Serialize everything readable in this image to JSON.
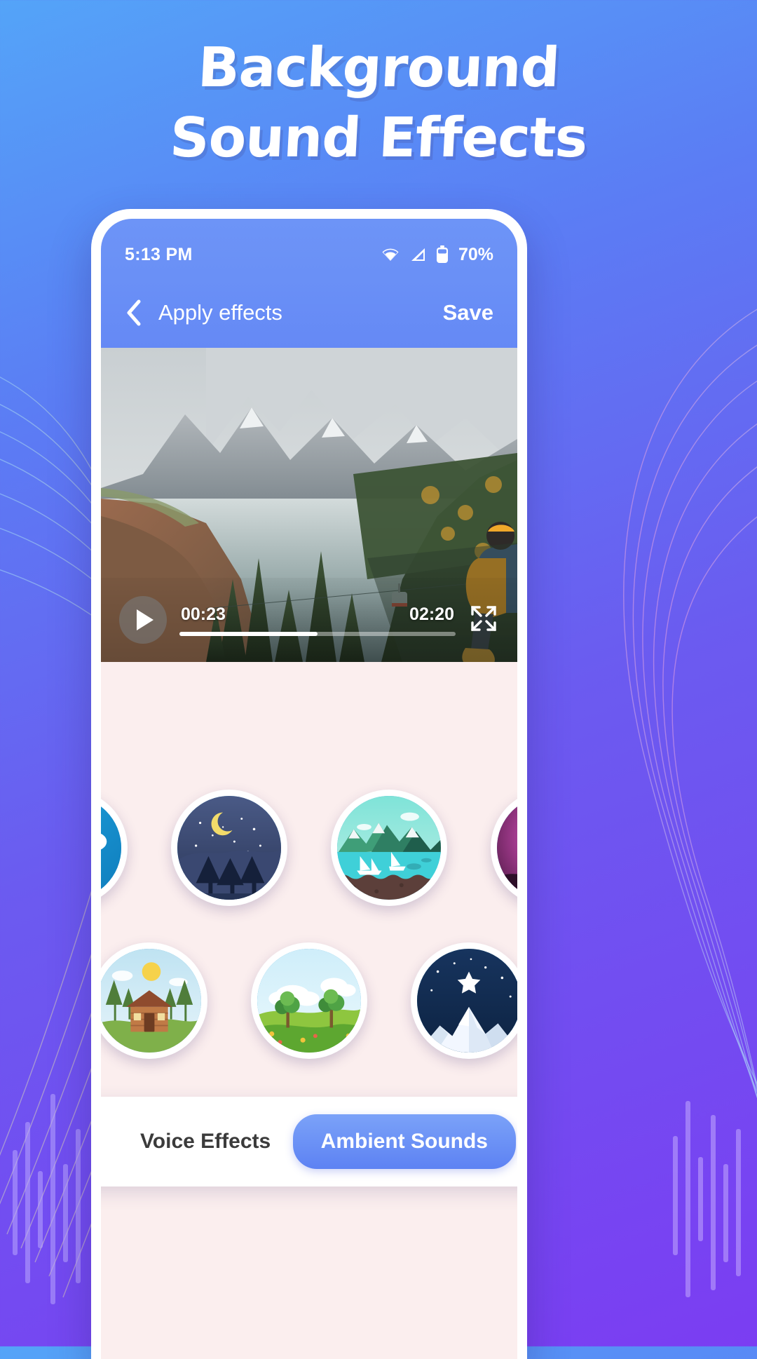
{
  "poster": {
    "title_line1": "Background",
    "title_line2": "Sound Effects",
    "bg_gradient_from": "#54a4f8",
    "bg_gradient_to": "#7b3df2"
  },
  "status_bar": {
    "time": "5:13 PM",
    "battery_percent": "70%",
    "icons": [
      "wifi-icon",
      "cellular-signal-icon",
      "battery-icon"
    ]
  },
  "app_bar": {
    "back_icon": "chevron-left-icon",
    "title": "Apply effects",
    "save_label": "Save",
    "accent": "#6a90f6"
  },
  "video": {
    "play_icon": "play-icon",
    "current_time": "00:23",
    "duration": "02:20",
    "progress_percent": 50,
    "fullscreen_icon": "fullscreen-expand-icon"
  },
  "tabs": {
    "inactive_label": "Voice Effects",
    "active_label": "Ambient Sounds",
    "active_color": "#5d82f3"
  },
  "sounds": {
    "row1": [
      {
        "name": "rain-thunder-sound",
        "icon": "rain-cloud-lightning-icon"
      },
      {
        "name": "night-forest-sound",
        "icon": "crescent-moon-night-forest-icon"
      },
      {
        "name": "lake-sailboat-sound",
        "icon": "lake-sailboats-mountains-icon"
      },
      {
        "name": "thunderstorm-sound",
        "icon": "lightning-storm-icon"
      }
    ],
    "row2": [
      {
        "name": "cabin-woods-sound",
        "icon": "cabin-house-trees-icon"
      },
      {
        "name": "meadow-sound",
        "icon": "green-meadow-trees-icon"
      },
      {
        "name": "snow-mountain-sound",
        "icon": "snowy-peak-star-icon"
      }
    ]
  }
}
